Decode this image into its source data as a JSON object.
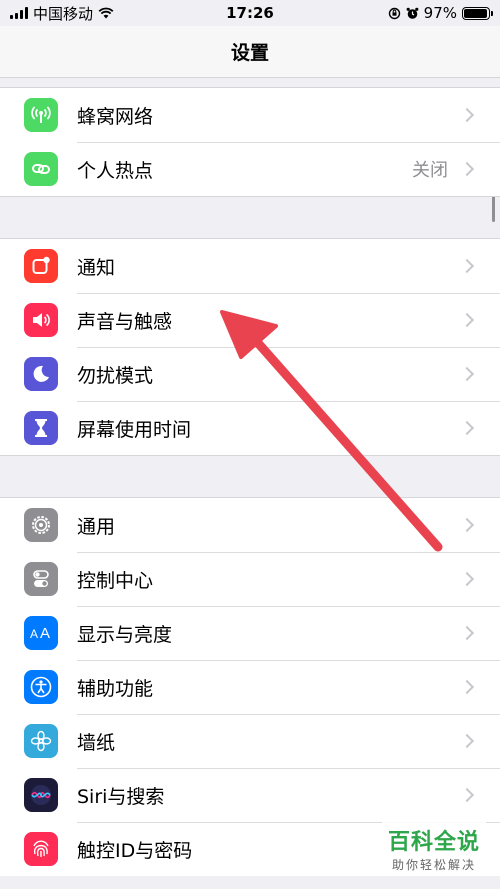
{
  "status_bar": {
    "carrier": "中国移动",
    "time": "17:26",
    "battery_text": "97%",
    "battery_level": 0.97
  },
  "nav": {
    "title": "设置"
  },
  "groups": [
    {
      "items": [
        {
          "label": "蜂窝网络",
          "icon": "cellular-antenna-icon",
          "color": "#4cd964"
        },
        {
          "label": "个人热点",
          "icon": "personal-hotspot-icon",
          "color": "#4cd964",
          "value": "关闭"
        }
      ]
    },
    {
      "items": [
        {
          "label": "通知",
          "icon": "notifications-icon",
          "color": "#ff3b30"
        },
        {
          "label": "声音与触感",
          "icon": "speaker-icon",
          "color": "#ff2d55"
        },
        {
          "label": "勿扰模式",
          "icon": "moon-icon",
          "color": "#5856d6"
        },
        {
          "label": "屏幕使用时间",
          "icon": "hourglass-icon",
          "color": "#5856d6"
        }
      ]
    },
    {
      "items": [
        {
          "label": "通用",
          "icon": "gear-icon",
          "color": "#8e8e93"
        },
        {
          "label": "控制中心",
          "icon": "toggles-icon",
          "color": "#8e8e93"
        },
        {
          "label": "显示与亮度",
          "icon": "text-size-icon",
          "color": "#007aff"
        },
        {
          "label": "辅助功能",
          "icon": "accessibility-icon",
          "color": "#007aff"
        },
        {
          "label": "墙纸",
          "icon": "flower-icon",
          "color": "#34aadc"
        },
        {
          "label": "Siri与搜索",
          "icon": "siri-icon",
          "color": "#1c1c3a"
        },
        {
          "label": "触控ID与密码",
          "icon": "fingerprint-icon",
          "color": "#ff2d55"
        }
      ]
    }
  ],
  "watermark": {
    "title": "百科全说",
    "subtitle": "助你轻松解决"
  }
}
